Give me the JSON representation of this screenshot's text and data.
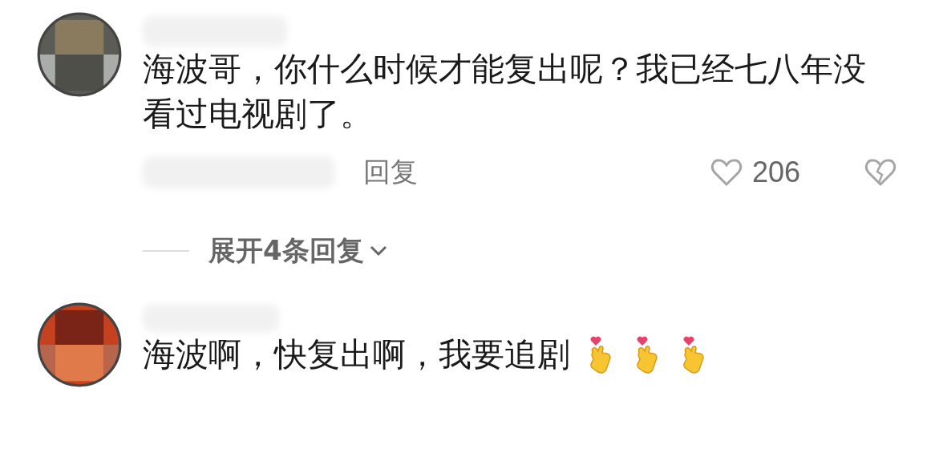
{
  "comments": [
    {
      "avatar": {
        "kind": "grey"
      },
      "text": "海波哥，你什么时候才能复出呢？我已经七八年没看过电视剧了。",
      "reply": "回复",
      "likes": "206",
      "expand": "展开4条回复"
    },
    {
      "avatar": {
        "kind": "red"
      },
      "text": "海波啊，快复出啊，我要追剧"
    }
  ]
}
